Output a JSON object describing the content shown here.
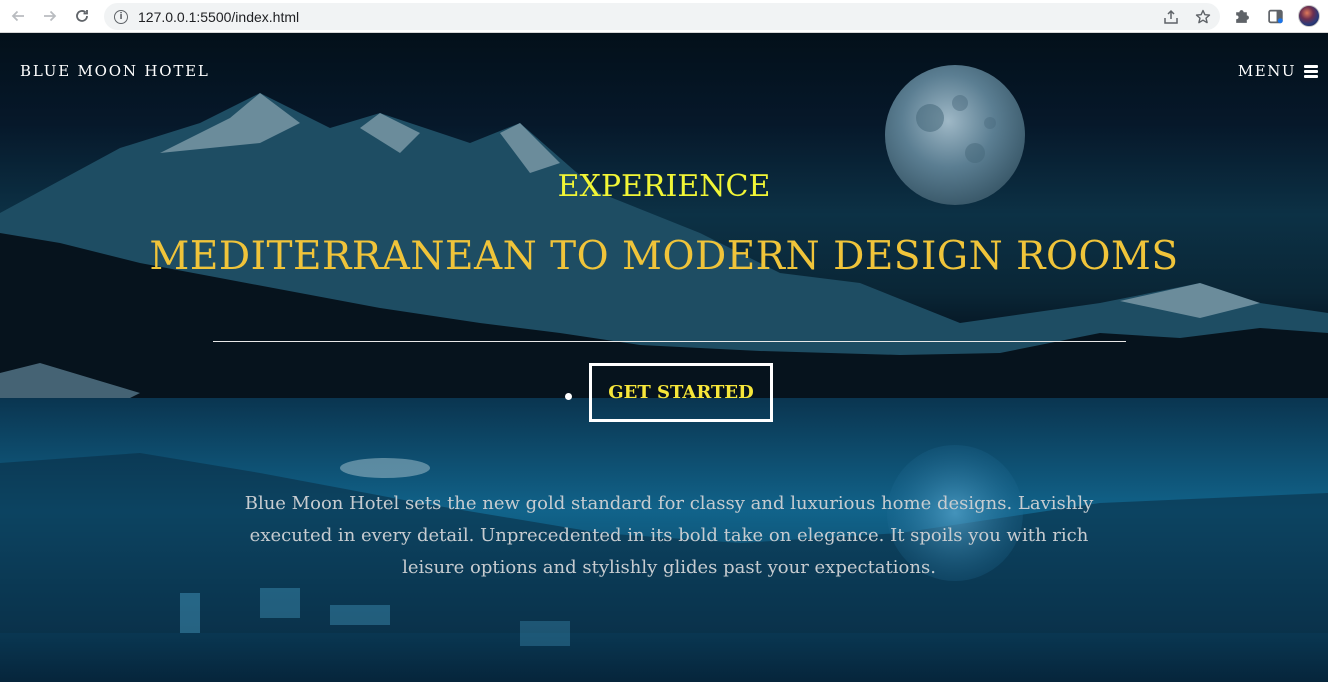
{
  "browser": {
    "url": "127.0.0.1:5500/index.html",
    "back_icon": "arrow-left-icon",
    "forward_icon": "arrow-right-icon",
    "reload_icon": "reload-icon",
    "info_icon": "info-icon",
    "info_glyph": "i",
    "share_icon": "share-icon",
    "bookmark_icon": "star-icon",
    "extensions_icon": "puzzle-icon",
    "sidepanel_icon": "sidepanel-icon",
    "profile_icon": "avatar"
  },
  "nav": {
    "brand": "BLUE MOON HOTEL",
    "menu_label": "MENU",
    "menu_icon": "hamburger-icon"
  },
  "hero": {
    "eyebrow": "EXPERIENCE",
    "headline": "MEDITERRANEAN TO MODERN DESIGN ROOMS",
    "cta_label": "GET STARTED",
    "description": "Blue Moon Hotel sets the new gold standard for classy and luxurious home designs. Lavishly executed in every detail. Unprecedented in its bold take on elegance. It spoils you with rich leisure options and stylishly glides past your expectations."
  },
  "colors": {
    "eyebrow": "#f1f536",
    "headline": "#f0c43a",
    "cta_text": "#f6e63a",
    "description": "#c7ccd0"
  }
}
